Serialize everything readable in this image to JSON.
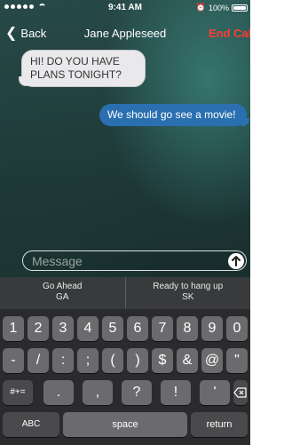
{
  "status_bar": {
    "time": "9:41 AM",
    "battery": "100%",
    "battery_level": 1.0
  },
  "nav": {
    "back_label": "Back",
    "title": "Jane Appleseed",
    "end_call_label": "End Call"
  },
  "messages": [
    {
      "from": "them",
      "text": "HI! DO YOU HAVE PLANS TONIGHT?"
    },
    {
      "from": "me",
      "text": "We should go see a movie!"
    }
  ],
  "input": {
    "placeholder": "Message"
  },
  "suggestions": [
    {
      "line1": "Go Ahead",
      "line2": "GA"
    },
    {
      "line1": "Ready to hang up",
      "line2": "SK"
    }
  ],
  "keyboard": {
    "row1": [
      "1",
      "2",
      "3",
      "4",
      "5",
      "6",
      "7",
      "8",
      "9",
      "0"
    ],
    "row2": [
      "-",
      "/",
      ":",
      ";",
      "(",
      ")",
      "$",
      "&",
      "@",
      "\""
    ],
    "row3": [
      ".",
      ",",
      "?",
      "!",
      "'"
    ],
    "shift_label": "#+=",
    "abc_label": "ABC",
    "space_label": "space",
    "return_label": "return"
  },
  "colors": {
    "end_call": "#ff3b30",
    "sent_bubble": "#2a6fb0",
    "received_bubble": "#e9e9ec"
  }
}
